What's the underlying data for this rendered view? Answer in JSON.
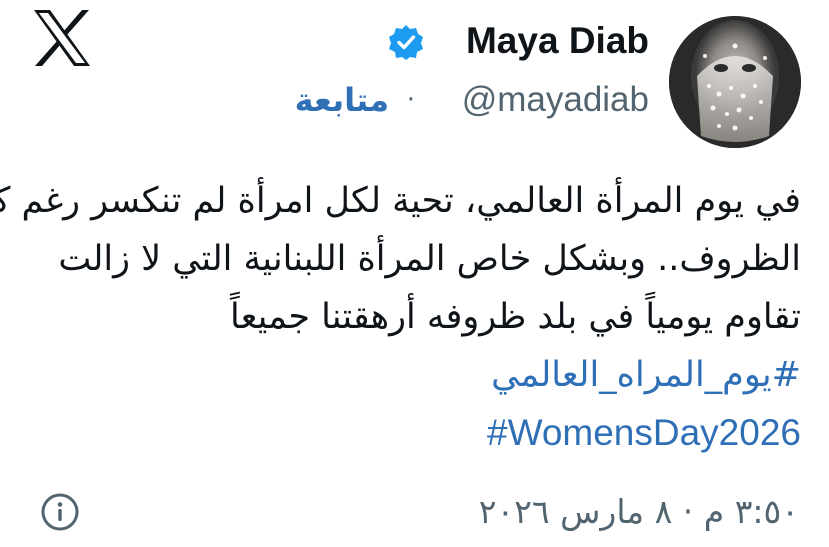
{
  "header": {
    "display_name": "Maya Diab",
    "handle": "@mayadiab",
    "separator": "·",
    "follow_label": "متابعة",
    "verified": true
  },
  "tweet": {
    "lines": [
      "في يوم المرأة العالمي، تحية لكل امرأة لم تنكسر رغم كل",
      "الظروف.. وبشكل خاص المرأة اللبنانية التي لا زالت",
      "تقاوم يومياً في بلد ظروفه أرهقتنا جميعاً"
    ],
    "hashtags": [
      "#يوم_المراه_العالمي",
      "#WomensDay2026"
    ]
  },
  "footer": {
    "timestamp": "٣:٥٠ م · ٨ مارس ٢٠٢٦"
  },
  "icons": {
    "brand": "x-logo-icon",
    "verified": "verified-badge-icon",
    "info": "info-icon"
  },
  "colors": {
    "link": "#2f6fb6",
    "verified": "#1d9bf0",
    "secondary_text": "#536471",
    "primary_text": "#0f1419"
  }
}
